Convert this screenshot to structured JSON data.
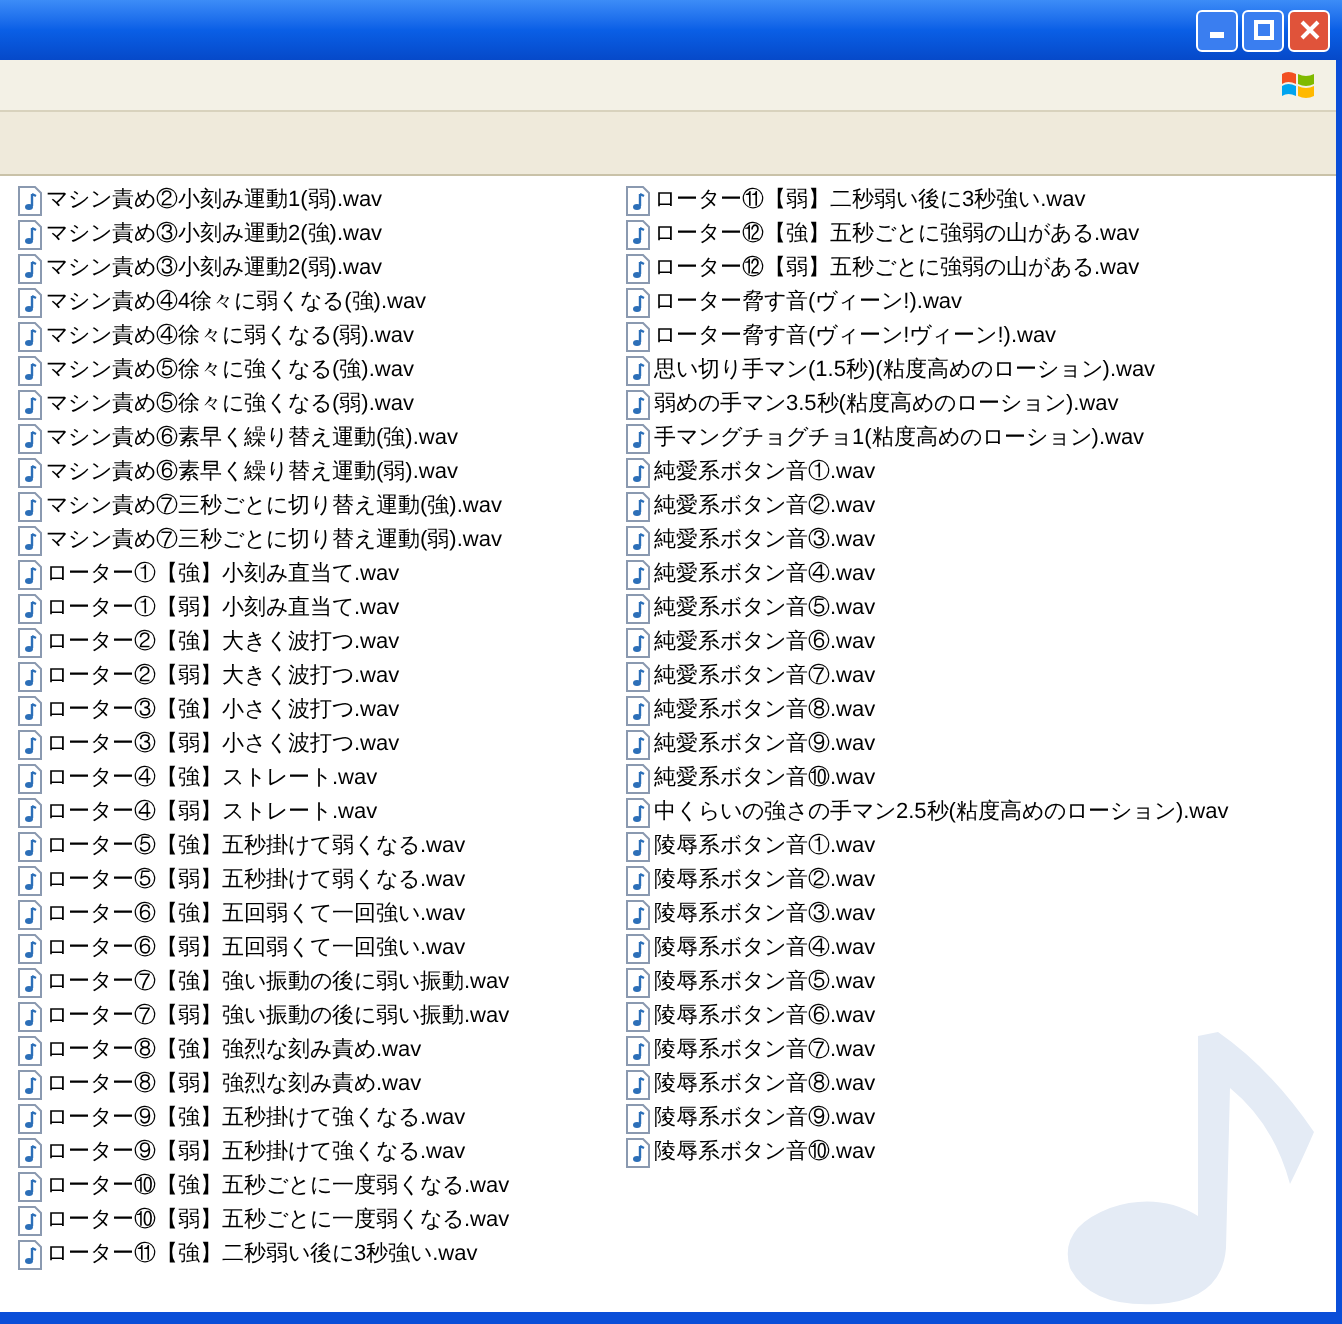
{
  "file_columns": [
    {
      "files": [
        "マシン責め②小刻み運動1(弱).wav",
        "マシン責め③小刻み運動2(強).wav",
        "マシン責め③小刻み運動2(弱).wav",
        "マシン責め④4徐々に弱くなる(強).wav",
        "マシン責め④徐々に弱くなる(弱).wav",
        "マシン責め⑤徐々に強くなる(強).wav",
        "マシン責め⑤徐々に強くなる(弱).wav",
        "マシン責め⑥素早く繰り替え運動(強).wav",
        "マシン責め⑥素早く繰り替え運動(弱).wav",
        "マシン責め⑦三秒ごとに切り替え運動(強).wav",
        "マシン責め⑦三秒ごとに切り替え運動(弱).wav",
        "ローター①【強】小刻み直当て.wav",
        "ローター①【弱】小刻み直当て.wav",
        "ローター②【強】大きく波打つ.wav",
        "ローター②【弱】大きく波打つ.wav",
        "ローター③【強】小さく波打つ.wav",
        "ローター③【弱】小さく波打つ.wav",
        "ローター④【強】ストレート.wav",
        "ローター④【弱】ストレート.wav",
        "ローター⑤【強】五秒掛けて弱くなる.wav",
        "ローター⑤【弱】五秒掛けて弱くなる.wav",
        "ローター⑥【強】五回弱くて一回強い.wav",
        "ローター⑥【弱】五回弱くて一回強い.wav",
        "ローター⑦【強】強い振動の後に弱い振動.wav",
        "ローター⑦【弱】強い振動の後に弱い振動.wav",
        "ローター⑧【強】強烈な刻み責め.wav",
        "ローター⑧【弱】強烈な刻み責め.wav",
        "ローター⑨【強】五秒掛けて強くなる.wav",
        "ローター⑨【弱】五秒掛けて強くなる.wav",
        "ローター⑩【強】五秒ごとに一度弱くなる.wav",
        "ローター⑩【弱】五秒ごとに一度弱くなる.wav",
        "ローター⑪【強】二秒弱い後に3秒強い.wav"
      ]
    },
    {
      "files": [
        "ローター⑪【弱】二秒弱い後に3秒強い.wav",
        "ローター⑫【強】五秒ごとに強弱の山がある.wav",
        "ローター⑫【弱】五秒ごとに強弱の山がある.wav",
        "ローター脅す音(ヴィーン!).wav",
        "ローター脅す音(ヴィーン!ヴィーン!).wav",
        "思い切り手マン(1.5秒)(粘度高めのローション).wav",
        "弱めの手マン3.5秒(粘度高めのローション).wav",
        "手マングチョグチョ1(粘度高めのローション).wav",
        "純愛系ボタン音①.wav",
        "純愛系ボタン音②.wav",
        "純愛系ボタン音③.wav",
        "純愛系ボタン音④.wav",
        "純愛系ボタン音⑤.wav",
        "純愛系ボタン音⑥.wav",
        "純愛系ボタン音⑦.wav",
        "純愛系ボタン音⑧.wav",
        "純愛系ボタン音⑨.wav",
        "純愛系ボタン音⑩.wav",
        "中くらいの強さの手マン2.5秒(粘度高めのローション).wav",
        "陵辱系ボタン音①.wav",
        "陵辱系ボタン音②.wav",
        "陵辱系ボタン音③.wav",
        "陵辱系ボタン音④.wav",
        "陵辱系ボタン音⑤.wav",
        "陵辱系ボタン音⑥.wav",
        "陵辱系ボタン音⑦.wav",
        "陵辱系ボタン音⑧.wav",
        "陵辱系ボタン音⑨.wav",
        "陵辱系ボタン音⑩.wav"
      ]
    }
  ]
}
